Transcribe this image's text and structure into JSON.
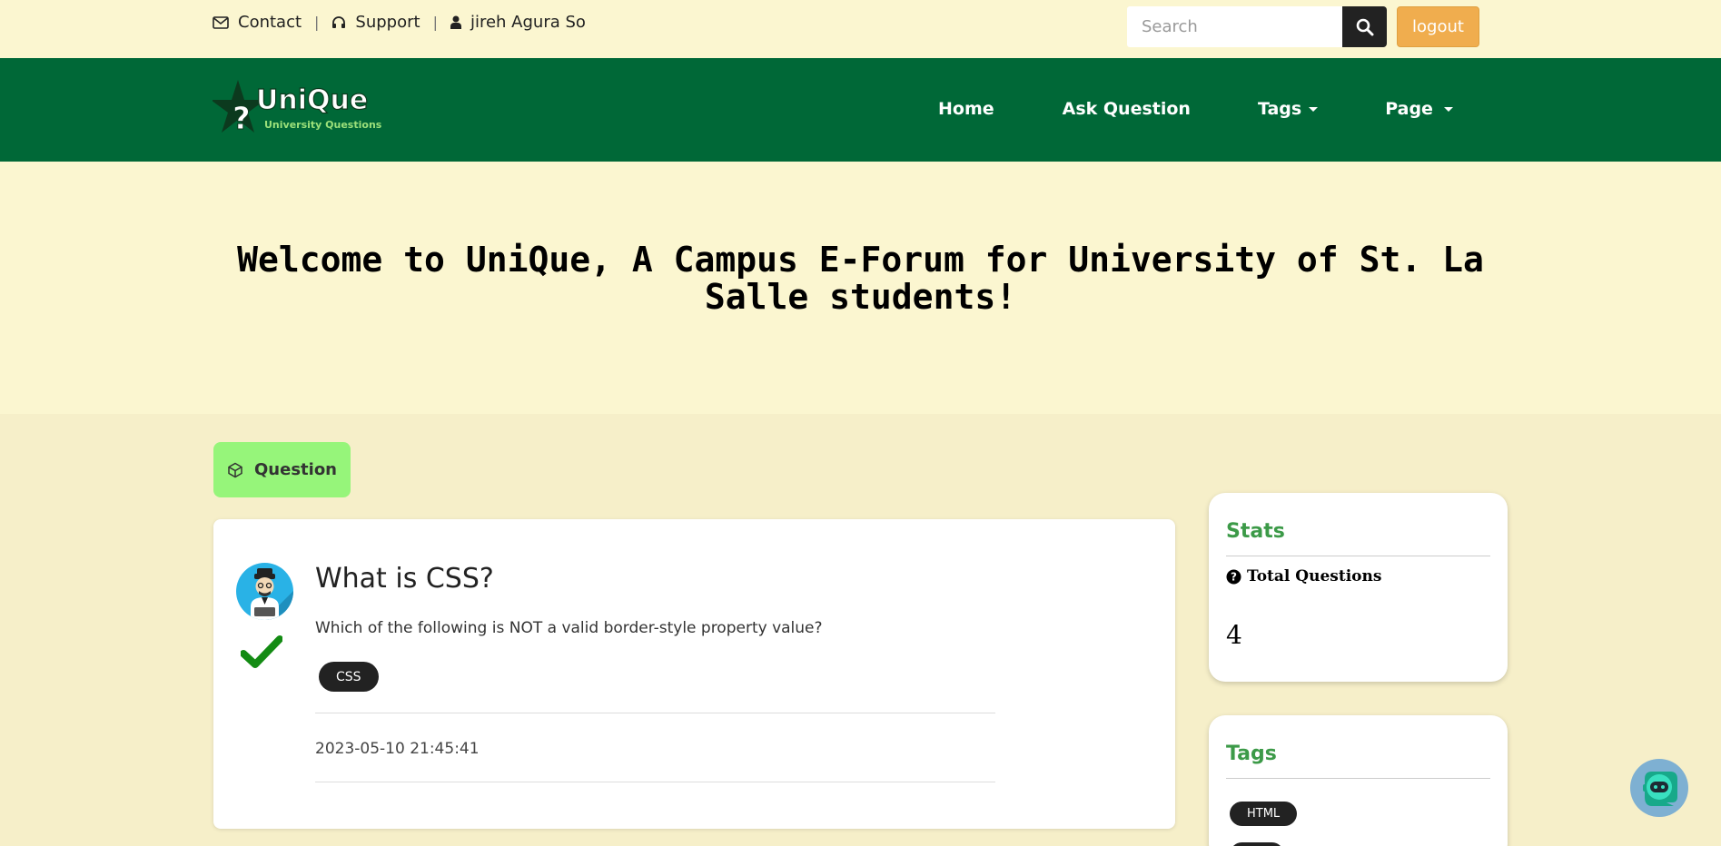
{
  "topbar": {
    "links": [
      {
        "label": "Contact",
        "icon": "envelope-icon"
      },
      {
        "label": "Support",
        "icon": "headphones-icon"
      },
      {
        "label": "jireh Agura So",
        "icon": "user-icon"
      }
    ],
    "separator": "|",
    "search_placeholder": "Search",
    "logout_label": "logout"
  },
  "navbar": {
    "brand_name": "UniQue",
    "brand_tagline": "University Questions",
    "items": [
      {
        "label": "Home",
        "dropdown": false
      },
      {
        "label": "Ask Question",
        "dropdown": false
      },
      {
        "label": "Tags",
        "dropdown": true
      },
      {
        "label": "Page",
        "dropdown": true
      }
    ]
  },
  "hero": {
    "title": "Welcome to UniQue, A Campus E-Forum for University of St. La Salle students!"
  },
  "main": {
    "tab_label": "Question",
    "question": {
      "title": "What is CSS?",
      "body": "Which of the following is NOT a valid border-style property value?",
      "tag": "CSS",
      "date": "2023-05-10 21:45:41",
      "answered": true
    }
  },
  "sidebar": {
    "stats": {
      "title": "Stats",
      "label": "Total Questions",
      "value": "4"
    },
    "tags": {
      "title": "Tags",
      "items": [
        "HTML"
      ]
    }
  },
  "colors": {
    "topbar_bg": "#fbf6d0",
    "nav_bg": "#006837",
    "page_bg": "#f6efc9",
    "accent_green": "#3c9a48",
    "tab_green": "#96f57a",
    "logout_orange": "#f0ad4e"
  }
}
